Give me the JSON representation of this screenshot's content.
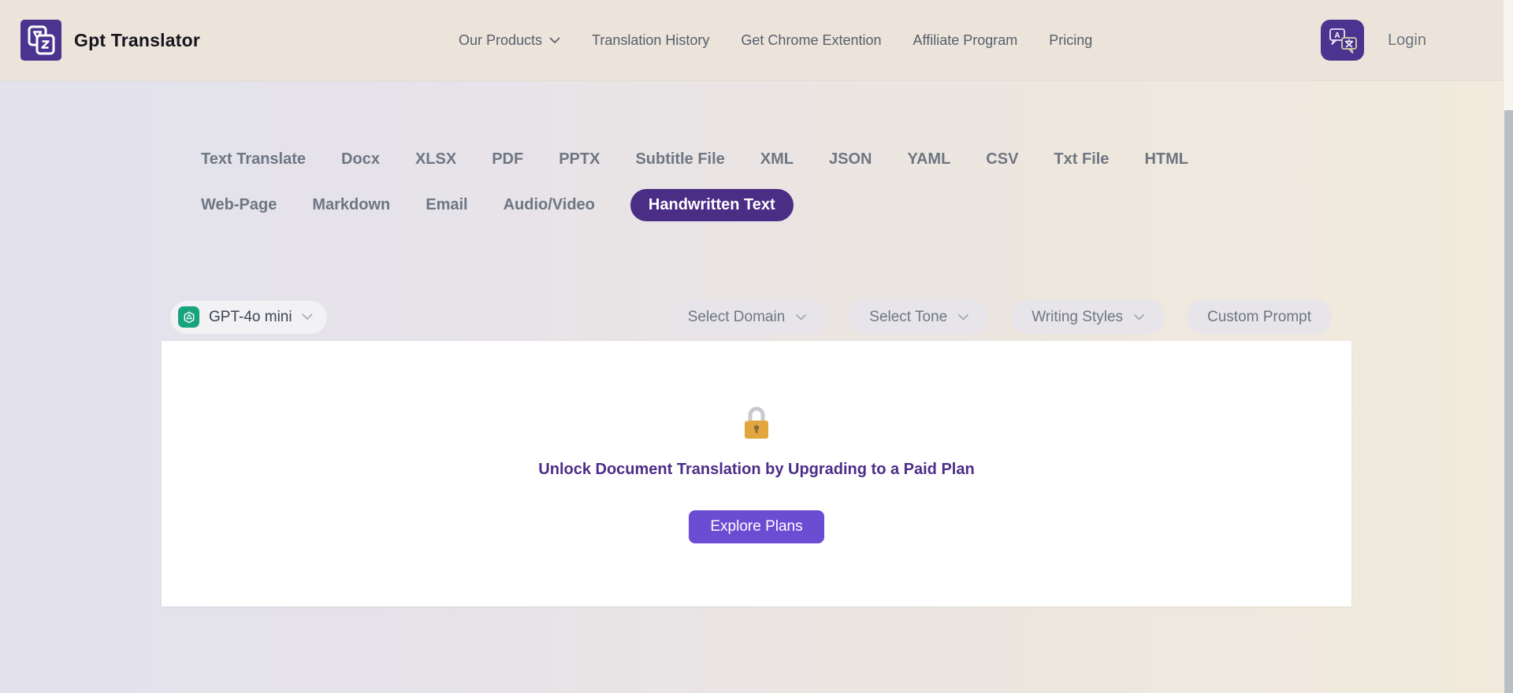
{
  "brand": {
    "name": "Gpt Translator"
  },
  "navbar": {
    "links": [
      {
        "label": "Our Products",
        "has_dropdown": true
      },
      {
        "label": "Translation History",
        "has_dropdown": false
      },
      {
        "label": "Get Chrome Extention",
        "has_dropdown": false
      },
      {
        "label": "Affiliate Program",
        "has_dropdown": false
      },
      {
        "label": "Pricing",
        "has_dropdown": false
      }
    ],
    "login_label": "Login"
  },
  "tabs": {
    "row1": [
      "Text Translate",
      "Docx",
      "XLSX",
      "PDF",
      "PPTX",
      "Subtitle File",
      "XML",
      "JSON",
      "YAML",
      "CSV",
      "Txt File",
      "HTML"
    ],
    "row2": [
      "Web-Page",
      "Markdown",
      "Email",
      "Audio/Video",
      "Handwritten Text"
    ],
    "active_tab": "Handwritten Text"
  },
  "controls": {
    "model_selector": {
      "value": "GPT-4o mini",
      "icon": "openai-icon"
    },
    "dropdowns": [
      {
        "label": "Select Domain",
        "has_chevron": true
      },
      {
        "label": "Select Tone",
        "has_chevron": true
      },
      {
        "label": "Writing Styles",
        "has_chevron": true
      },
      {
        "label": "Custom Prompt",
        "has_chevron": false
      }
    ]
  },
  "upgrade_card": {
    "icon": "lock-icon",
    "message": "Unlock Document Translation by Upgrading to a Paid Plan",
    "button_label": "Explore Plans"
  },
  "icons": {
    "brand": "translate-logo-icon",
    "nav_button": "translator-speech-bubbles-icon",
    "model": "openai-icon",
    "card": "lock-icon",
    "dropdown": "chevron-down-icon"
  },
  "colors": {
    "accent": "#4a2d85",
    "logo-purple": "#4a3490",
    "button-purple": "#6b4dd3",
    "heading-purple": "#4b2d87",
    "openai-green": "#17a37c",
    "navbar-bg": "#ece4da",
    "bg-left": "#e2e1ed",
    "bg-right": "#f1eadd"
  }
}
